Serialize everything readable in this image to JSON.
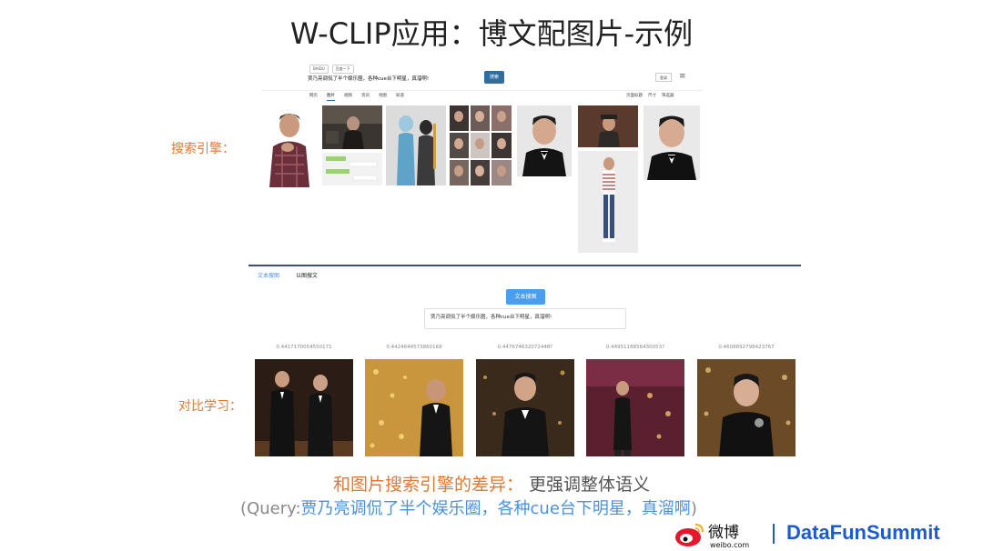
{
  "slide": {
    "title": "W-CLIP应用：博文配图片-示例"
  },
  "search_engine": {
    "label": "搜索引擎：",
    "mini_tabs": [
      "BAIDU",
      "百度一下"
    ],
    "query": "贾乃亮调侃了半个娱乐圈，各种cue台下明星，真溜啊!",
    "search_button": "搜索",
    "login_button": "登录",
    "nav": [
      "网页",
      "图片",
      "视频",
      "资讯",
      "地图",
      "知道"
    ],
    "nav_active": "图片",
    "filters": [
      "页面标题",
      "尺寸",
      "筛选器"
    ]
  },
  "contrastive": {
    "label": "对比学习：",
    "tabs": [
      "文本搜图",
      "以图搜文"
    ],
    "active_tab": "文本搜图",
    "button": "文本搜图",
    "textarea_value": "贾乃亮调侃了半个娱乐圈，各种cue台下明星，真溜啊!",
    "scores": [
      "0.4417170054550171",
      "0.4424644573860168",
      "0.447674632072448?",
      "0.4495118856430053?",
      "0.4608892798423767"
    ]
  },
  "bottom": {
    "line1_orange": "和图片搜索引擎的差异：",
    "line1_gray": " 更强调整体语义",
    "line2_prefix": "(Query:",
    "line2_blue": "贾乃亮调侃了半个娱乐圈，各种cue台下明星，真溜啊",
    "line2_suffix": ")"
  },
  "footer": {
    "weibo_text": "微博",
    "weibo_domain": "weibo.com",
    "brand": "DataFunSummit"
  },
  "colors": {
    "accent_orange": "#e8772e",
    "accent_blue": "#4a90e2",
    "brand_blue": "#1b5bd0",
    "divider": "#3b4a8a"
  }
}
